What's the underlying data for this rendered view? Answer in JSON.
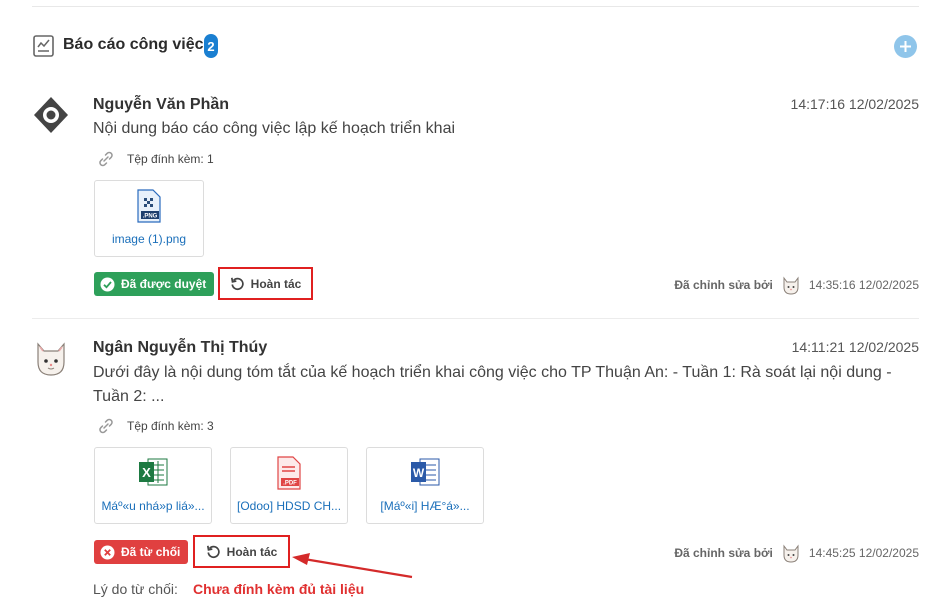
{
  "header": {
    "title": "Báo cáo công việc",
    "count": "2"
  },
  "reports": [
    {
      "author": "Nguyễn Văn Phần",
      "time": "14:17:16 12/02/2025",
      "content": "Nội dung báo cáo công việc lập kế hoạch triển khai",
      "attachments_label": "Tệp đính kèm: 1",
      "files": [
        {
          "name": "image (1).png",
          "type": "PNG"
        }
      ],
      "status": "Đã được duyệt",
      "undo_label": "Hoàn tác",
      "edited_by": "Đã chỉnh sửa bởi",
      "edited_time": "14:35:16 12/02/2025"
    },
    {
      "author": "Ngân Nguyễn Thị Thúy",
      "time": "14:11:21 12/02/2025",
      "content": "Dưới đây là nội dung tóm tắt của kế hoạch triển khai công việc cho TP Thuận An: - Tuần 1: Rà soát lại nội dung - Tuần 2: ...",
      "attachments_label": "Tệp đính kèm: 3",
      "files": [
        {
          "name": "Máº«u nhá»p liá»...",
          "type": "XLSX"
        },
        {
          "name": "[Odoo] HDSD CH...",
          "type": "PDF"
        },
        {
          "name": "[Máº«i] HÆ°á»...",
          "type": "DOCX"
        }
      ],
      "status": "Đã từ chối",
      "undo_label": "Hoàn tác",
      "edited_by": "Đã chỉnh sửa bởi",
      "edited_time": "14:45:25 12/02/2025",
      "reject_reason_label": "Lý do từ chối:",
      "reject_reason": "Chưa đính kèm đủ tài liệu"
    }
  ],
  "colors": {
    "approved": "#2ea05a",
    "rejected": "#e04040",
    "highlight": "#e02020",
    "link": "#1a6fba",
    "badge": "#1a7fd1"
  },
  "icons": {
    "header": "report-icon",
    "add": "plus-icon",
    "attachment": "link-icon",
    "undo": "undo-icon",
    "approved": "check-circle-icon",
    "rejected": "x-circle-icon"
  }
}
